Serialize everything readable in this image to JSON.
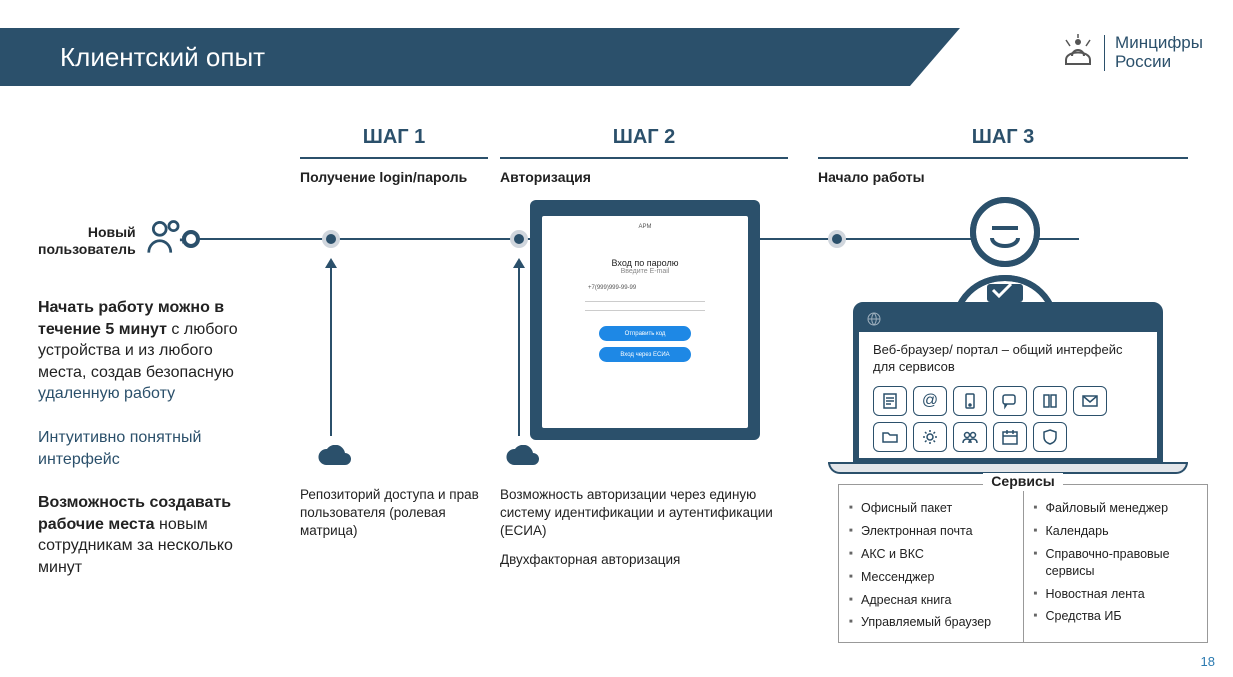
{
  "header": {
    "title": "Клиентский опыт"
  },
  "logo": {
    "line1": "Минцифры",
    "line2": "России"
  },
  "left": {
    "user": "Новый пользователь",
    "p1a": "Начать работу можно в течение 5 минут",
    "p1b": " с любого устройства и из любого места, создав безопасную ",
    "p1c": "удаленную работу",
    "p2": "Интуитивно понятный интерфейс",
    "p3a": "Возможность создавать рабочие места",
    "p3b": " новым сотрудникам за несколько минут"
  },
  "steps": {
    "s1": {
      "title": "ШАГ 1",
      "sub": "Получение login/пароль",
      "desc": "Репозиторий доступа и прав пользователя (ролевая матрица)"
    },
    "s2": {
      "title": "ШАГ 2",
      "sub": "Авторизация",
      "desc1": "Возможность авторизации через единую систему идентификации и аутентификации (ЕСИА)",
      "desc2": "Двухфакторная авторизация",
      "tablet": {
        "brand": "АРМ",
        "title": "Вход по паролю",
        "sub": "Введите E-mail",
        "field": "+7(999)999-99-99",
        "btn1": "Отправить код",
        "btn2": "Вход через ЕСИА"
      }
    },
    "s3": {
      "title": "ШАГ 3",
      "sub": "Начало работы",
      "laptop": "Веб-браузер/ портал – общий интерфейс для сервисов"
    }
  },
  "services": {
    "title": "Сервисы",
    "col1": [
      "Офисный пакет",
      "Электронная почта",
      "АКС и ВКС",
      "Мессенджер",
      "Адресная книга",
      "Управляемый браузер"
    ],
    "col2": [
      "Файловый менеджер",
      "Календарь",
      "Справочно-правовые сервисы",
      "Новостная лента",
      "Средства ИБ"
    ]
  },
  "page": "18"
}
